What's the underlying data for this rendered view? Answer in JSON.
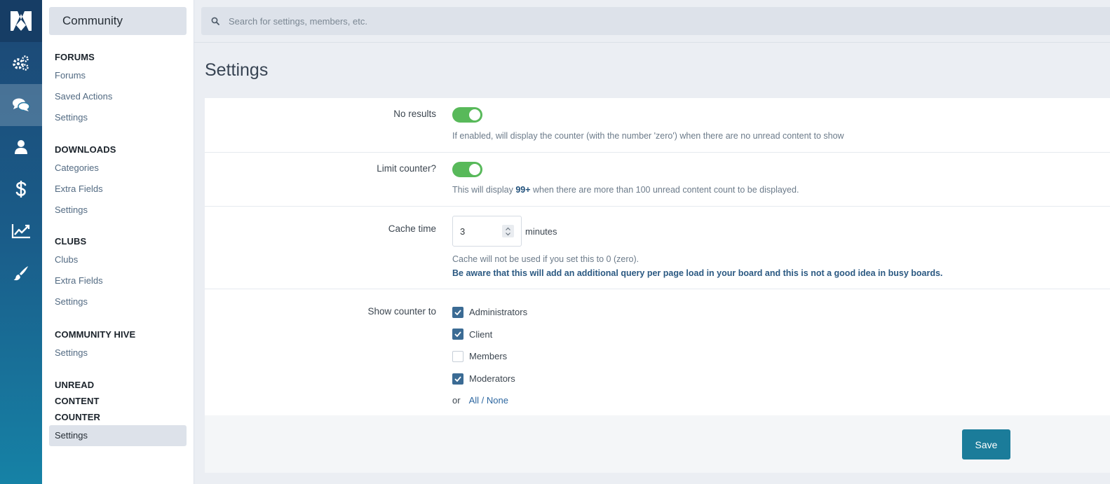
{
  "rail": {
    "items": [
      {
        "icon": "system-icon",
        "active": false
      },
      {
        "icon": "community-icon",
        "active": true
      },
      {
        "icon": "members-icon",
        "active": false
      },
      {
        "icon": "commerce-icon",
        "active": false
      },
      {
        "icon": "stats-icon",
        "active": false
      },
      {
        "icon": "customization-icon",
        "active": false
      }
    ]
  },
  "subnav": {
    "title": "Community",
    "sections": [
      {
        "title": "FORUMS",
        "links": [
          "Forums",
          "Saved Actions",
          "Settings"
        ]
      },
      {
        "title": "DOWNLOADS",
        "links": [
          "Categories",
          "Extra Fields",
          "Settings"
        ]
      },
      {
        "title": "CLUBS",
        "links": [
          "Clubs",
          "Extra Fields",
          "Settings"
        ]
      },
      {
        "title": "COMMUNITY HIVE",
        "links": [
          "Settings"
        ]
      },
      {
        "title": "UNREAD CONTENT COUNTER",
        "links": [
          "Settings"
        ],
        "active_index": 0
      }
    ]
  },
  "header": {
    "search_placeholder": "Search for settings, members, etc."
  },
  "page": {
    "title": "Settings"
  },
  "form": {
    "no_results": {
      "label": "No results",
      "enabled": true,
      "desc": "If enabled, will display the counter (with the number 'zero') when there are no unread content to show"
    },
    "limit_counter": {
      "label": "Limit counter?",
      "enabled": true,
      "desc_pre": "This will display ",
      "desc_bold": "99+",
      "desc_post": " when there are more than 100 unread content count to be displayed."
    },
    "cache_time": {
      "label": "Cache time",
      "value": "3",
      "suffix": "minutes",
      "desc": "Cache will not be used if you set this to 0 (zero).",
      "warning": "Be aware that this will add an additional query per page load in your board and this is not a good idea in busy boards."
    },
    "show_counter": {
      "label": "Show counter to",
      "options": [
        {
          "label": "Administrators",
          "checked": true
        },
        {
          "label": "Client",
          "checked": true
        },
        {
          "label": "Members",
          "checked": false
        },
        {
          "label": "Moderators",
          "checked": true
        }
      ],
      "or_label": "or",
      "all_none_label": "All / None"
    },
    "save_label": "Save"
  },
  "colors": {
    "rail_top": "#1c4774",
    "rail_bottom": "#1682a6",
    "toggle_on": "#58b95a",
    "checkbox_on": "#3b6b94",
    "save_button": "#1b7c9a"
  }
}
